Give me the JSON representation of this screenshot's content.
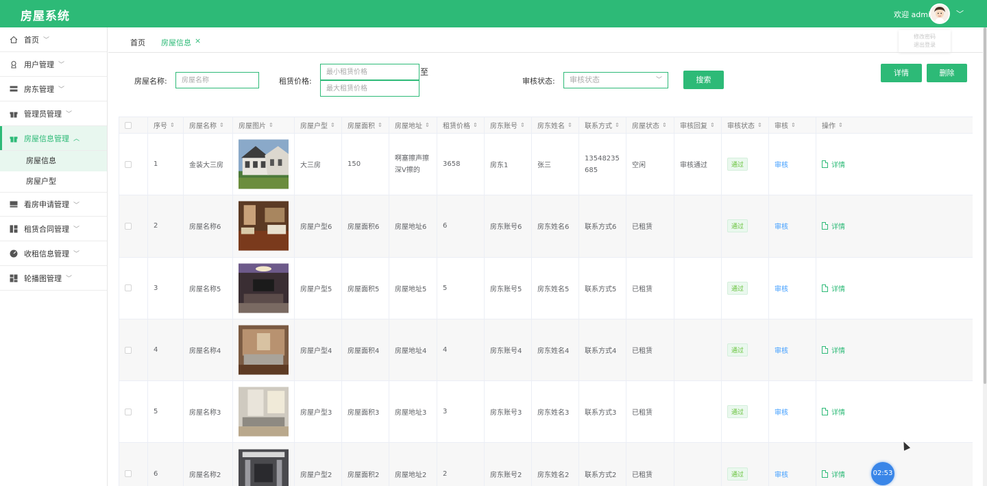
{
  "header": {
    "title": "房屋系统",
    "welcome": "欢迎 admin",
    "dropdown_items": [
      "修改密码",
      "退出登录"
    ]
  },
  "sidebar": {
    "items": [
      {
        "label": "首页",
        "icon": "home-icon"
      },
      {
        "label": "用户管理",
        "icon": "user-icon"
      },
      {
        "label": "房东管理",
        "icon": "list-icon"
      },
      {
        "label": "管理员管理",
        "icon": "gift-icon"
      },
      {
        "label": "房屋信息管理",
        "icon": "house-icon",
        "active": true
      },
      {
        "label": "看房申请管理",
        "icon": "screen-icon"
      },
      {
        "label": "租赁合同管理",
        "icon": "grid-icon"
      },
      {
        "label": "收租信息管理",
        "icon": "pie-icon"
      },
      {
        "label": "轮播图管理",
        "icon": "dashboard-icon"
      }
    ],
    "subitems": [
      "房屋信息",
      "房屋户型"
    ]
  },
  "tabs": [
    {
      "label": "首页"
    },
    {
      "label": "房屋信息",
      "active": true,
      "close": "×"
    }
  ],
  "search": {
    "name_label": "房屋名称:",
    "name_placeholder": "房屋名称",
    "price_label": "租赁价格:",
    "min_placeholder": "最小租赁价格",
    "max_placeholder": "最大租赁价格",
    "to_label": "至",
    "status_label": "审核状态:",
    "status_placeholder": "审核状态",
    "search_button": "搜索",
    "detail_button": "详情",
    "delete_button": "删除"
  },
  "table": {
    "columns": [
      "序号",
      "房屋名称",
      "房屋图片",
      "房屋户型",
      "房屋面积",
      "房屋地址",
      "租赁价格",
      "房东账号",
      "房东姓名",
      "联系方式",
      "房屋状态",
      "审核回复",
      "审核状态",
      "审核",
      "操作"
    ],
    "rows": [
      {
        "no": "1",
        "name": "金装大三房",
        "type": "大三房",
        "area": "150",
        "address": "啊塞擦声擦深V擦的",
        "price": "3658",
        "account": "房东1",
        "owner": "张三",
        "phone": "13548235685",
        "status": "空闲",
        "reply": "审核通过",
        "audit_status": "通过",
        "audit": "审核",
        "op": "详情"
      },
      {
        "no": "2",
        "name": "房屋名称6",
        "type": "房屋户型6",
        "area": "房屋面积6",
        "address": "房屋地址6",
        "price": "6",
        "account": "房东账号6",
        "owner": "房东姓名6",
        "phone": "联系方式6",
        "status": "已租赁",
        "reply": "",
        "audit_status": "通过",
        "audit": "审核",
        "op": "详情"
      },
      {
        "no": "3",
        "name": "房屋名称5",
        "type": "房屋户型5",
        "area": "房屋面积5",
        "address": "房屋地址5",
        "price": "5",
        "account": "房东账号5",
        "owner": "房东姓名5",
        "phone": "联系方式5",
        "status": "已租赁",
        "reply": "",
        "audit_status": "通过",
        "audit": "审核",
        "op": "详情"
      },
      {
        "no": "4",
        "name": "房屋名称4",
        "type": "房屋户型4",
        "area": "房屋面积4",
        "address": "房屋地址4",
        "price": "4",
        "account": "房东账号4",
        "owner": "房东姓名4",
        "phone": "联系方式4",
        "status": "已租赁",
        "reply": "",
        "audit_status": "通过",
        "audit": "审核",
        "op": "详情"
      },
      {
        "no": "5",
        "name": "房屋名称3",
        "type": "房屋户型3",
        "area": "房屋面积3",
        "address": "房屋地址3",
        "price": "3",
        "account": "房东账号3",
        "owner": "房东姓名3",
        "phone": "联系方式3",
        "status": "已租赁",
        "reply": "",
        "audit_status": "通过",
        "audit": "审核",
        "op": "详情"
      },
      {
        "no": "6",
        "name": "房屋名称2",
        "type": "房屋户型2",
        "area": "房屋面积2",
        "address": "房屋地址2",
        "price": "2",
        "account": "房东账号2",
        "owner": "房东姓名2",
        "phone": "联系方式2",
        "status": "已租赁",
        "reply": "",
        "audit_status": "通过",
        "audit": "审核",
        "op": "详情"
      }
    ]
  },
  "timer": "02:53",
  "colors": {
    "primary": "#2dba77",
    "link": "#409eff",
    "badge_text": "#67c23a"
  }
}
